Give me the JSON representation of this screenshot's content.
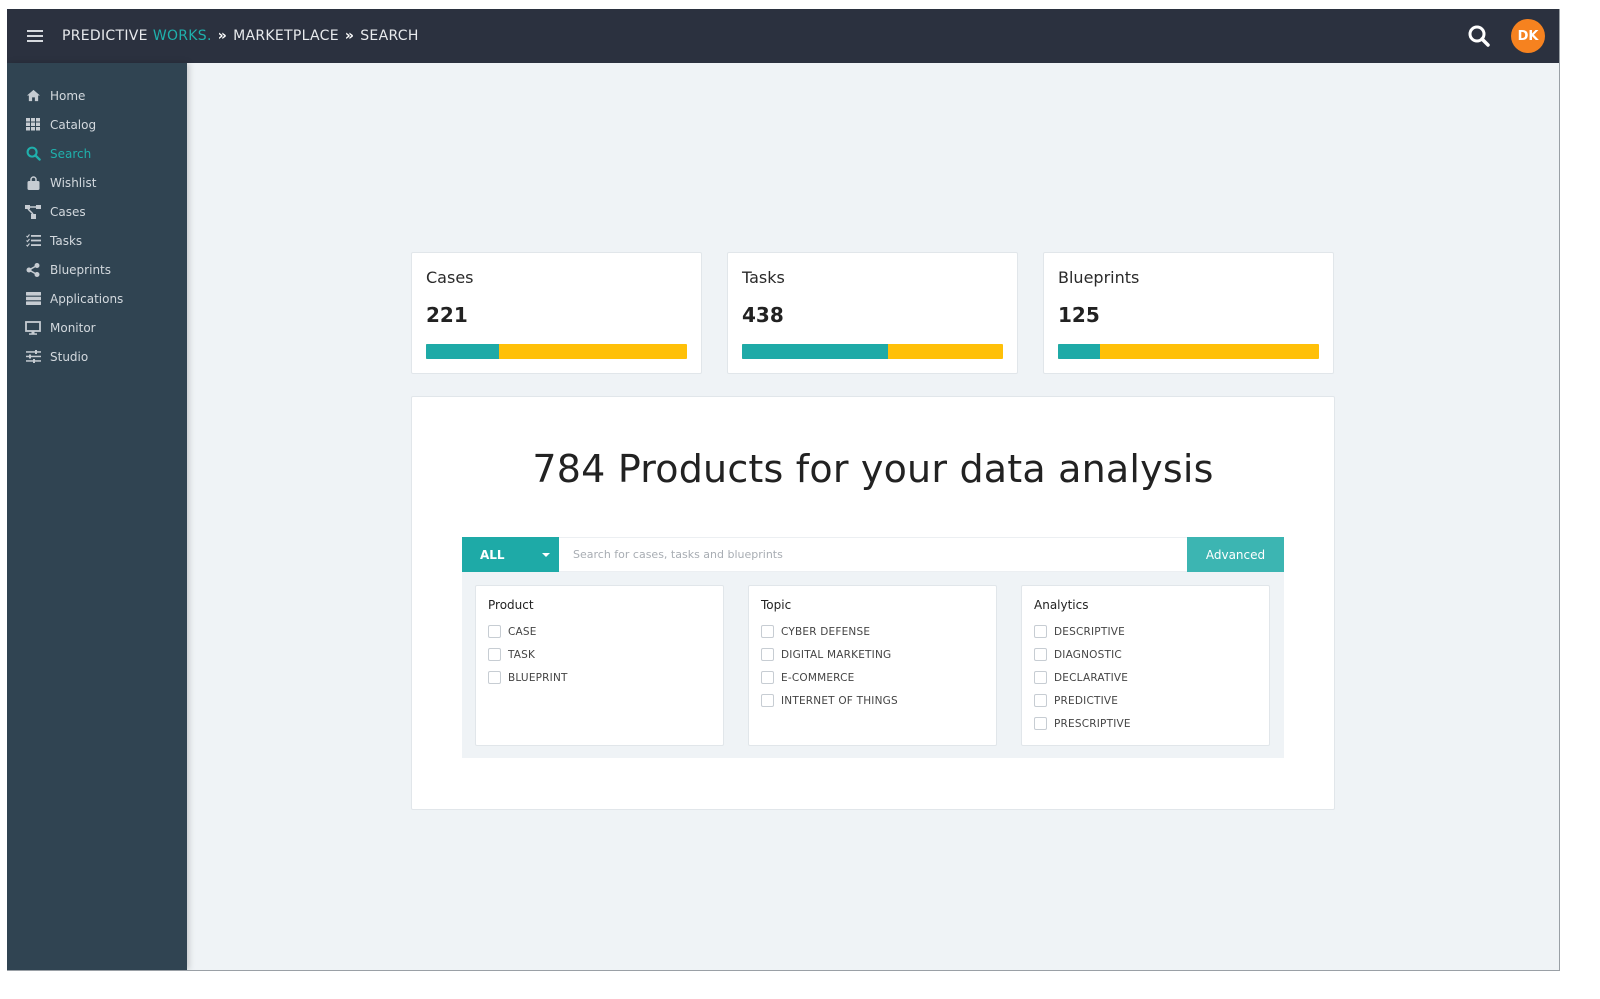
{
  "topbar": {
    "brand_main": "PREDICTIVE",
    "brand_accent": "WORKS.",
    "breadcrumb": [
      "MARKETPLACE",
      "SEARCH"
    ],
    "separator": "»",
    "avatar_initials": "DK"
  },
  "colors": {
    "accent": "#1eaaa7",
    "secondary": "#ffc008",
    "avatar": "#f6821f",
    "topbar_bg": "#2b313f",
    "sidebar_bg": "#304452"
  },
  "sidebar": {
    "items": [
      {
        "label": "Home",
        "icon": "home-icon"
      },
      {
        "label": "Catalog",
        "icon": "grid-icon"
      },
      {
        "label": "Search",
        "icon": "search-icon",
        "active": true
      },
      {
        "label": "Wishlist",
        "icon": "shopping-bag-icon"
      },
      {
        "label": "Cases",
        "icon": "sitemap-icon"
      },
      {
        "label": "Tasks",
        "icon": "task-list-icon"
      },
      {
        "label": "Blueprints",
        "icon": "share-icon"
      },
      {
        "label": "Applications",
        "icon": "server-icon"
      },
      {
        "label": "Monitor",
        "icon": "monitor-icon"
      },
      {
        "label": "Studio",
        "icon": "sliders-icon"
      }
    ]
  },
  "stats": [
    {
      "title": "Cases",
      "value": "221",
      "fraction": 0.28
    },
    {
      "title": "Tasks",
      "value": "438",
      "fraction": 0.56
    },
    {
      "title": "Blueprints",
      "value": "125",
      "fraction": 0.16
    }
  ],
  "main": {
    "headline": "784 Products for your data analysis",
    "scope_select": "ALL",
    "search_placeholder": "Search for cases, tasks and blueprints",
    "search_value": "",
    "advanced_label": "Advanced"
  },
  "filters": [
    {
      "title": "Product",
      "options": [
        "CASE",
        "TASK",
        "BLUEPRINT"
      ]
    },
    {
      "title": "Topic",
      "options": [
        "CYBER DEFENSE",
        "DIGITAL MARKETING",
        "E-COMMERCE",
        "INTERNET OF THINGS"
      ]
    },
    {
      "title": "Analytics",
      "options": [
        "DESCRIPTIVE",
        "DIAGNOSTIC",
        "DECLARATIVE",
        "PREDICTIVE",
        "PRESCRIPTIVE"
      ]
    }
  ]
}
